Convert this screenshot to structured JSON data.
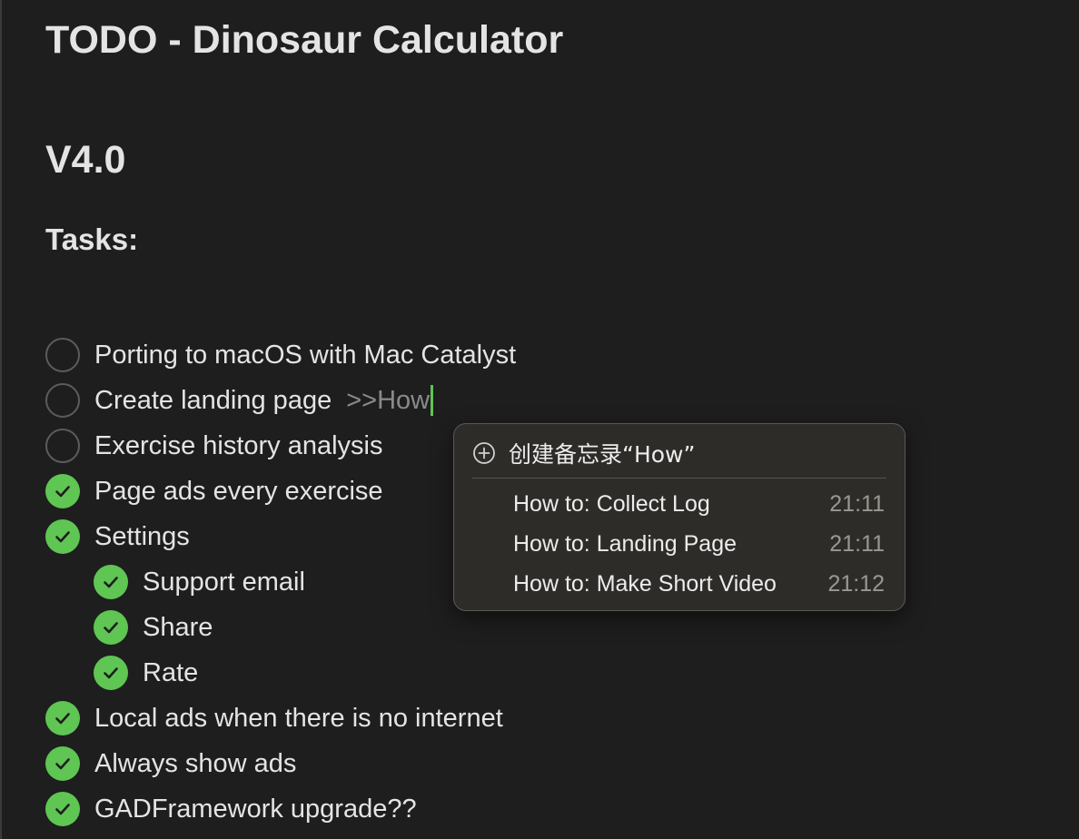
{
  "note": {
    "title": "TODO - Dinosaur Calculator",
    "version_heading": "V4.0",
    "tasks_heading": "Tasks:"
  },
  "tasks": [
    {
      "label": "Porting to macOS with Mac Catalyst",
      "done": false,
      "level": 0
    },
    {
      "label": "Create landing page",
      "done": false,
      "level": 0,
      "typed_link": ">>How"
    },
    {
      "label": "Exercise history analysis",
      "done": false,
      "level": 0
    },
    {
      "label": "Page ads every exercise",
      "done": true,
      "level": 0
    },
    {
      "label": "Settings",
      "done": true,
      "level": 0
    },
    {
      "label": "Support email",
      "done": true,
      "level": 1
    },
    {
      "label": "Share",
      "done": true,
      "level": 1
    },
    {
      "label": "Rate",
      "done": true,
      "level": 1
    },
    {
      "label": "Local ads when there is no internet",
      "done": true,
      "level": 0
    },
    {
      "label": "Always show ads",
      "done": true,
      "level": 0
    },
    {
      "label": "GADFramework upgrade??",
      "done": true,
      "level": 0
    }
  ],
  "link_popup": {
    "create_label": "创建备忘录“How”",
    "create_icon": "plus-circle-icon",
    "suggestions": [
      {
        "title": "How to: Collect Log",
        "time": "21:11"
      },
      {
        "title": "How to: Landing Page",
        "time": "21:11"
      },
      {
        "title": "How to: Make Short Video",
        "time": "21:12"
      }
    ]
  },
  "colors": {
    "background": "#1e1e1e",
    "checked": "#5fc553",
    "caret": "#5fc553",
    "popup_bg": "#2e2c29"
  }
}
